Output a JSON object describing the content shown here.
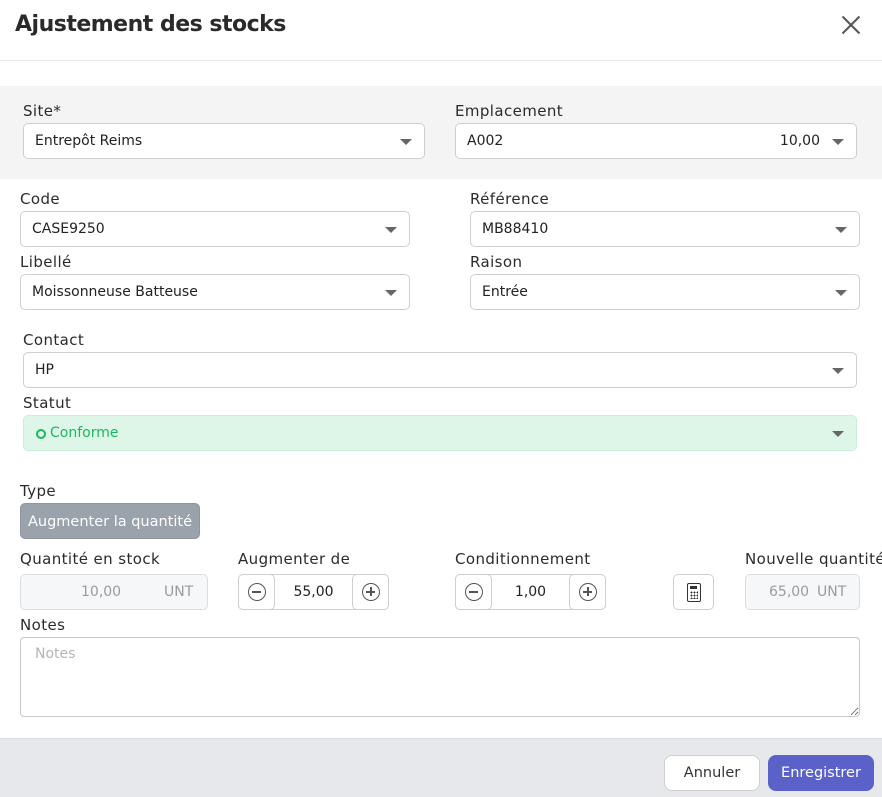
{
  "dialog": {
    "title": "Ajustement des stocks"
  },
  "site": {
    "label": "Site*",
    "value": "Entrepôt Reims"
  },
  "emplacement": {
    "label": "Emplacement",
    "value": "A002",
    "quantity": "10,00"
  },
  "code": {
    "label": "Code",
    "value": "CASE9250"
  },
  "reference": {
    "label": "Référence",
    "value": "MB88410"
  },
  "libelle": {
    "label": "Libellé",
    "value": "Moissonneuse Batteuse"
  },
  "raison": {
    "label": "Raison",
    "value": "Entrée"
  },
  "contact": {
    "label": "Contact",
    "value": "HP"
  },
  "statut": {
    "label": "Statut",
    "value": "Conforme",
    "color": "#1db760"
  },
  "type": {
    "label": "Type",
    "button_label": "Augmenter la quantité"
  },
  "quantite_stock": {
    "label": "Quantité en stock",
    "value": "10,00",
    "unit": "UNT"
  },
  "augmenter": {
    "label": "Augmenter de",
    "value": "55,00"
  },
  "conditionnement": {
    "label": "Conditionnement",
    "value": "1,00"
  },
  "nouvelle_quantite": {
    "label": "Nouvelle quantité",
    "value": "65,00",
    "unit": "UNT"
  },
  "notes": {
    "label": "Notes",
    "placeholder": "Notes",
    "value": ""
  },
  "footer": {
    "cancel_label": "Annuler",
    "save_label": "Enregistrer",
    "accent_color": "#5a62c9"
  }
}
